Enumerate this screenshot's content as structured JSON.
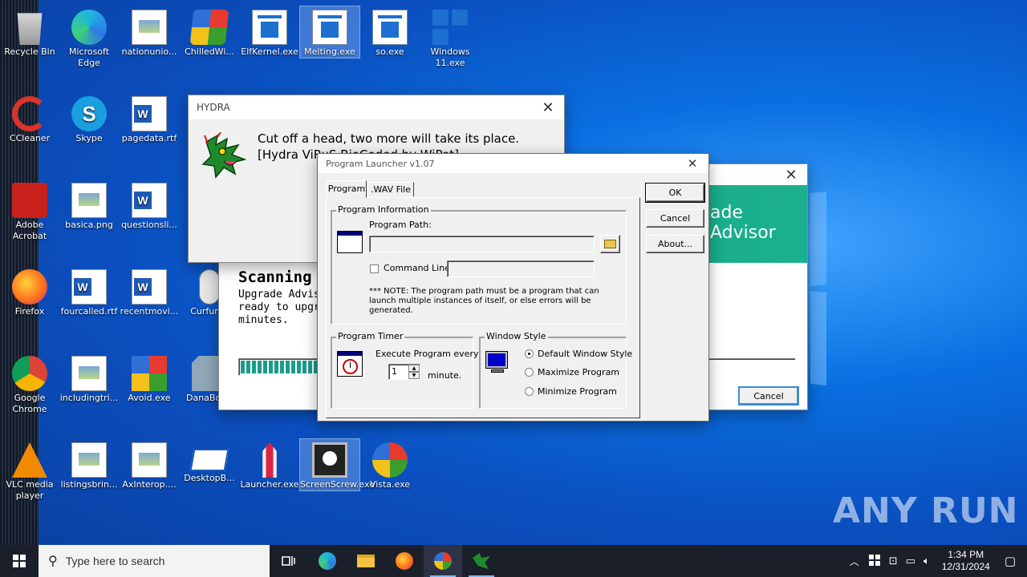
{
  "desktop": {
    "icons": [
      {
        "label": "Recycle Bin"
      },
      {
        "label": "Microsoft Edge"
      },
      {
        "label": "nationunio..."
      },
      {
        "label": "ChilledWi..."
      },
      {
        "label": "ElfKernel.exe"
      },
      {
        "label": "Melting.exe"
      },
      {
        "label": "so.exe"
      },
      {
        "label": "Windows 11.exe"
      },
      {
        "label": "CCleaner"
      },
      {
        "label": "Skype"
      },
      {
        "label": "pagedata.rtf"
      },
      {
        "label": "Adobe Acrobat"
      },
      {
        "label": "basica.png"
      },
      {
        "label": "questionsli..."
      },
      {
        "label": "Firefox"
      },
      {
        "label": "fourcalled.rtf"
      },
      {
        "label": "recentmovi..."
      },
      {
        "label": "Curfun..."
      },
      {
        "label": "Google Chrome"
      },
      {
        "label": "includingtri..."
      },
      {
        "label": "Avoid.exe"
      },
      {
        "label": "DanaBot..."
      },
      {
        "label": "VLC media player"
      },
      {
        "label": "listingsbrin..."
      },
      {
        "label": "AxInterop...."
      },
      {
        "label": "DesktopB..."
      },
      {
        "label": "Launcher.exe"
      },
      {
        "label": "ScreenScrew.exe"
      },
      {
        "label": "Vista.exe"
      }
    ],
    "watermark": "ANY RUN"
  },
  "hydra": {
    "title": "HYDRA",
    "line1": "Cut off a head, two more will take its place.",
    "line2": "[Hydra ViRuS BioCoded by WiPet]"
  },
  "upgrade": {
    "banner": "ade Advisor",
    "heading": "Scanning s",
    "body1": "Upgrade Adviso",
    "body2": "ready to upgra",
    "body3": "minutes.",
    "progress": 0.35,
    "cancel": "Cancel"
  },
  "launcher": {
    "title": "Program Launcher v1.07",
    "tabs": [
      "Program",
      ".WAV File"
    ],
    "ok": "OK",
    "cancel": "Cancel",
    "about": "About...",
    "info_group": "Program Information",
    "program_path_label": "Program Path:",
    "program_path_value": "",
    "command_line_label": "Command Line",
    "command_line_value": "",
    "note": "*** NOTE: The program path must be a program that can launch multiple instances of itself, or else errors will be generated.",
    "timer_group": "Program Timer",
    "execute_label": "Execute Program every",
    "interval": "1",
    "minute_label": "minute.",
    "style_group": "Window Style",
    "styles": [
      "Default Window Style",
      "Maximize Program",
      "Minimize Program"
    ],
    "selected_style": 0
  },
  "taskbar": {
    "search_placeholder": "Type here to search",
    "time": "1:34 PM",
    "date": "12/31/2024"
  }
}
